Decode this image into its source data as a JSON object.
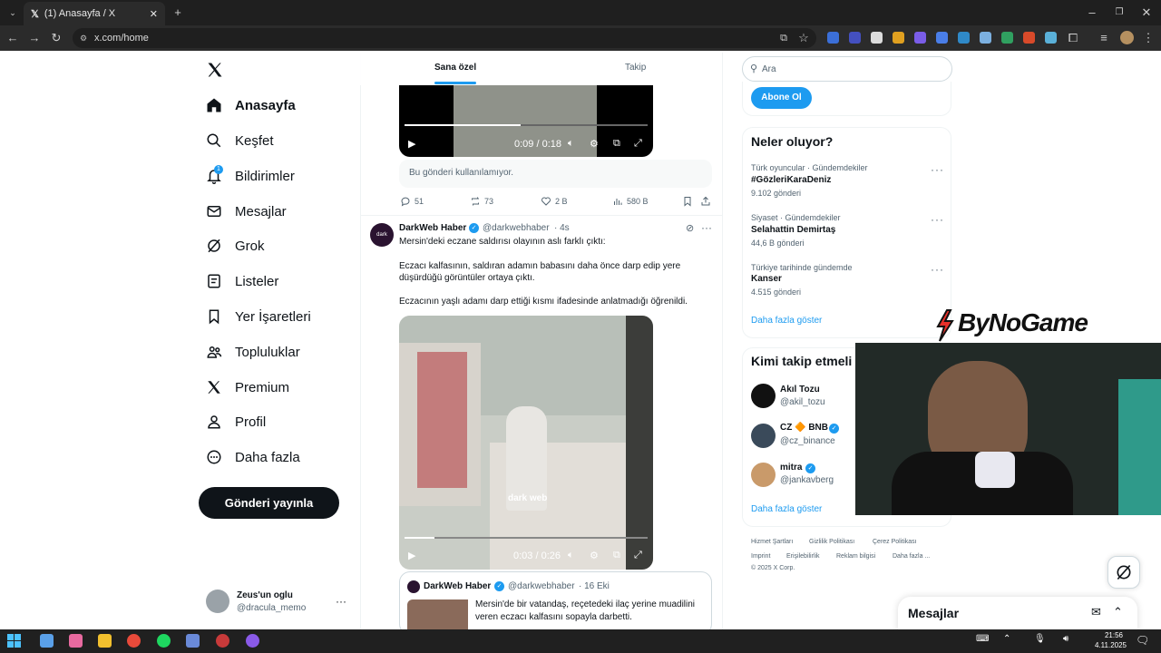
{
  "browser": {
    "tab_title": "(1) Anasayfa / X",
    "url": "x.com/home"
  },
  "nav": {
    "items": [
      {
        "label": "Anasayfa",
        "icon": "home-icon"
      },
      {
        "label": "Keşfet",
        "icon": "search-icon"
      },
      {
        "label": "Bildirimler",
        "icon": "bell-icon",
        "badge": "1"
      },
      {
        "label": "Mesajlar",
        "icon": "mail-icon"
      },
      {
        "label": "Grok",
        "icon": "grok-icon"
      },
      {
        "label": "Listeler",
        "icon": "list-icon"
      },
      {
        "label": "Yer İşaretleri",
        "icon": "bookmark-icon"
      },
      {
        "label": "Topluluklar",
        "icon": "communities-icon"
      },
      {
        "label": "Premium",
        "icon": "x-logo-icon"
      },
      {
        "label": "Profil",
        "icon": "profile-icon"
      },
      {
        "label": "Daha fazla",
        "icon": "more-icon"
      }
    ],
    "post_button": "Gönderi yayınla",
    "account": {
      "name": "Zeus'un oglu",
      "handle": "@dracula_memo"
    }
  },
  "feed": {
    "tabs": [
      "Sana özel",
      "Takip"
    ],
    "post1": {
      "video_time": "0:09 / 0:18",
      "unavailable": "Bu gönderi kullanılamıyor.",
      "replies": "51",
      "reposts": "73",
      "likes": "2 B",
      "views": "580 B"
    },
    "post2": {
      "author": "DarkWeb Haber",
      "handle": "@darkwebhaber",
      "time": "· 4s",
      "avatar_text": "dark",
      "text1": "Mersin'deki eczane saldırısı olayının aslı farklı çıktı:",
      "text2": "Eczacı kalfasının, saldıran adamın babasını daha önce darp edip yere",
      "text3": "düşürdüğü görüntüler ortaya çıktı.",
      "text4": "Eczacının yaşlı adamı darp ettiği kısmı ifadesinde anlatmadığı öğrenildi.",
      "video_time": "0:03 / 0:26",
      "watermark": "dark web"
    },
    "quote": {
      "author": "DarkWeb Haber",
      "handle": "@darkwebhaber",
      "time": "· 16 Eki",
      "text1": "Mersin'de bir vatandaş, reçetedeki ilaç yerine muadilini",
      "text2": "veren eczacı kalfasını sopayla darbetti."
    }
  },
  "sidebar": {
    "search_placeholder": "Ara",
    "subscribe": "Abone Ol",
    "trends_title": "Neler oluyor?",
    "trends": [
      {
        "meta": "Türk oyuncular · Gündemdekiler",
        "name": "#GözleriKaraDeniz",
        "count": "9.102 gönderi"
      },
      {
        "meta": "Siyaset · Gündemdekiler",
        "name": "Selahattin Demirtaş",
        "count": "44,6 B gönderi"
      },
      {
        "meta": "Türkiye tarihinde gündemde",
        "name": "Kanser",
        "count": "4.515 gönderi"
      }
    ],
    "show_more": "Daha fazla göster",
    "who_to_follow": "Kimi takip etmeli",
    "follow": [
      {
        "name": "Akıl Tozu",
        "handle": "@akil_tozu"
      },
      {
        "name": "CZ 🔶 BNB",
        "handle": "@cz_binance"
      },
      {
        "name": "mitra",
        "handle": "@jankavberg"
      }
    ],
    "show_more2": "Daha fazla göster",
    "footer": [
      "Hizmet Şartları",
      "Gizlilik Politikası",
      "Çerez Politikası",
      "Imprint",
      "Erişilebilirlik",
      "Reklam bilgisi",
      "Daha fazla ...",
      "© 2025 X Corp."
    ]
  },
  "overlay": {
    "logo": "ByNoGame"
  },
  "messages_drawer": {
    "title": "Mesajlar"
  },
  "taskbar": {
    "time": "21:56",
    "date": "4.11.2025"
  },
  "colors": {
    "accent": "#1d9bf0",
    "text": "#0f1419",
    "muted": "#536471"
  }
}
